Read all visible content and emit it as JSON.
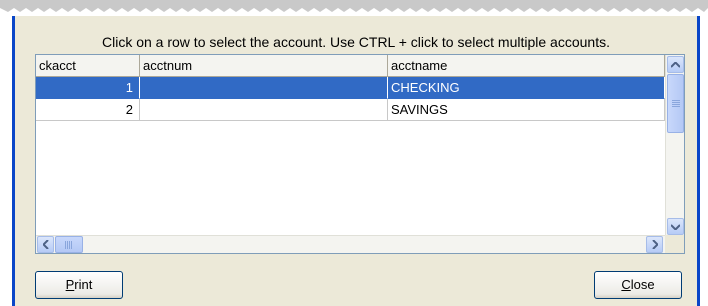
{
  "instruction": "Click on a row to select the account.  Use CTRL + click to select multiple accounts.",
  "table": {
    "columns": [
      "ckacct",
      "acctnum",
      "acctname"
    ],
    "rows": [
      {
        "ckacct": "1",
        "acctnum": "",
        "acctname": "CHECKING",
        "selected": true
      },
      {
        "ckacct": "2",
        "acctnum": "",
        "acctname": "SAVINGS",
        "selected": false
      }
    ]
  },
  "buttons": {
    "print": {
      "mnemonic": "P",
      "rest": "rint"
    },
    "close": {
      "mnemonic": "C",
      "rest": "lose"
    }
  },
  "icons": {
    "scroll_up": "up-arrow-icon",
    "scroll_down": "down-arrow-icon",
    "scroll_left": "left-arrow-icon",
    "scroll_right": "right-arrow-icon"
  },
  "colors": {
    "selection": "#316ac5",
    "window_frame": "#0a46c8",
    "dialog_bg": "#ece9d8"
  }
}
